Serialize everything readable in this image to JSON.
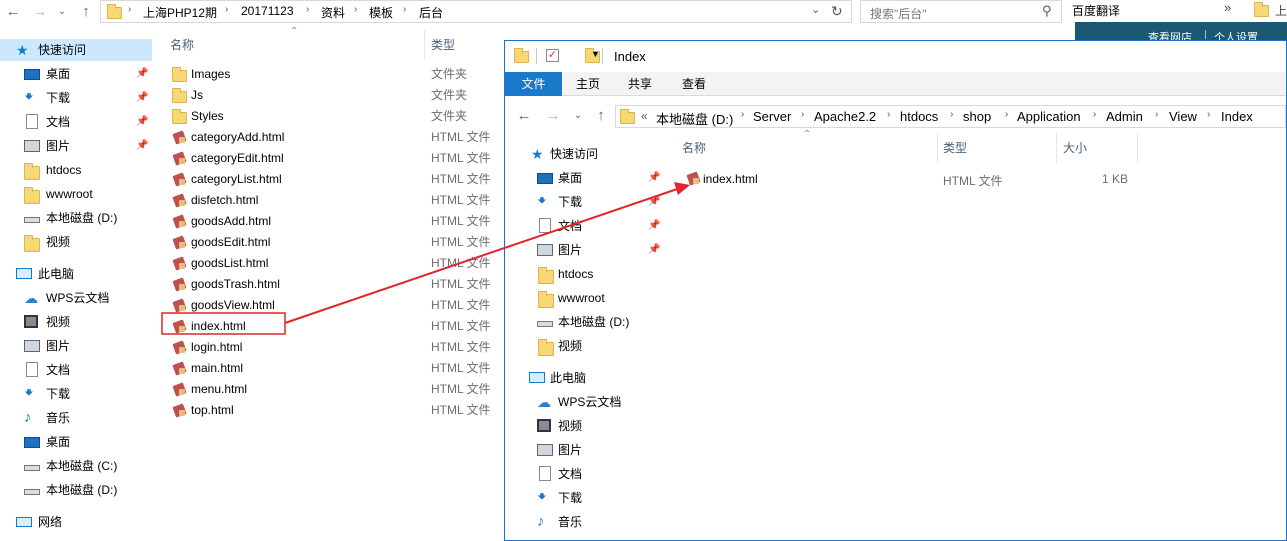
{
  "main_window": {
    "breadcrumbs": [
      "上海PHP12期",
      "20171123",
      "资料",
      "模板",
      "后台"
    ],
    "search_placeholder": "搜索\"后台\"",
    "columns": {
      "name": "名称",
      "type": "类型"
    },
    "nav": {
      "quick_access": "快速访问",
      "quick_items": [
        "桌面",
        "下载",
        "文档",
        "图片",
        "htdocs",
        "wwwroot",
        "本地磁盘 (D:)",
        "视频"
      ],
      "this_pc": "此电脑",
      "pc_items": [
        "WPS云文档",
        "视频",
        "图片",
        "文档",
        "下载",
        "音乐",
        "桌面",
        "本地磁盘 (C:)",
        "本地磁盘 (D:)"
      ],
      "network": "网络"
    },
    "files": [
      {
        "name": "Images",
        "type": "文件夹",
        "kind": "folder"
      },
      {
        "name": "Js",
        "type": "文件夹",
        "kind": "folder"
      },
      {
        "name": "Styles",
        "type": "文件夹",
        "kind": "folder"
      },
      {
        "name": "categoryAdd.html",
        "type": "HTML 文件",
        "kind": "html"
      },
      {
        "name": "categoryEdit.html",
        "type": "HTML 文件",
        "kind": "html"
      },
      {
        "name": "categoryList.html",
        "type": "HTML 文件",
        "kind": "html"
      },
      {
        "name": "disfetch.html",
        "type": "HTML 文件",
        "kind": "html"
      },
      {
        "name": "goodsAdd.html",
        "type": "HTML 文件",
        "kind": "html"
      },
      {
        "name": "goodsEdit.html",
        "type": "HTML 文件",
        "kind": "html"
      },
      {
        "name": "goodsList.html",
        "type": "HTML 文件",
        "kind": "html"
      },
      {
        "name": "goodsTrash.html",
        "type": "HTML 文件",
        "kind": "html"
      },
      {
        "name": "goodsView.html",
        "type": "HTML 文件",
        "kind": "html"
      },
      {
        "name": "index.html",
        "type": "HTML 文件",
        "kind": "html"
      },
      {
        "name": "login.html",
        "type": "HTML 文件",
        "kind": "html"
      },
      {
        "name": "main.html",
        "type": "HTML 文件",
        "kind": "html"
      },
      {
        "name": "menu.html",
        "type": "HTML 文件",
        "kind": "html"
      },
      {
        "name": "top.html",
        "type": "HTML 文件",
        "kind": "html"
      }
    ]
  },
  "browser_strip": {
    "translate": "百度翻译",
    "link1": "查看网店",
    "link2": "个人设置"
  },
  "second_window": {
    "title": "Index",
    "ribbon_tabs": [
      "文件",
      "主页",
      "共享",
      "查看"
    ],
    "breadcrumbs": [
      "本地磁盘 (D:)",
      "Server",
      "Apache2.2",
      "htdocs",
      "shop",
      "Application",
      "Admin",
      "View",
      "Index"
    ],
    "columns": {
      "name": "名称",
      "type": "类型",
      "size": "大小"
    },
    "nav": {
      "quick_access": "快速访问",
      "quick_items": [
        "桌面",
        "下载",
        "文档",
        "图片",
        "htdocs",
        "wwwroot",
        "本地磁盘 (D:)",
        "视频"
      ],
      "this_pc": "此电脑",
      "pc_items": [
        "WPS云文档",
        "视频",
        "图片",
        "文档",
        "下载",
        "音乐"
      ]
    },
    "files": [
      {
        "name": "index.html",
        "type": "HTML 文件",
        "size": "1 KB"
      }
    ]
  },
  "annotation": {
    "highlight_color": "#e0262b"
  }
}
